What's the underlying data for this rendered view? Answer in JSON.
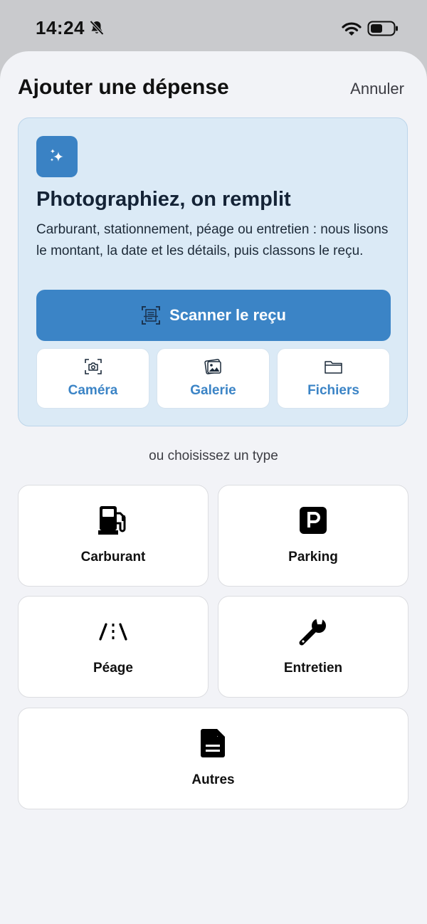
{
  "status_bar": {
    "time": "14:24"
  },
  "header": {
    "title": "Ajouter une dépense",
    "cancel_label": "Annuler"
  },
  "scan_card": {
    "title": "Photographiez, on remplit",
    "description": "Carburant, stationnement, péage ou entretien : nous lisons le montant, la date et les détails, puis classons le reçu.",
    "scan_button_label": "Scanner le reçu",
    "sources": [
      {
        "label": "Caméra",
        "icon": "camera-icon"
      },
      {
        "label": "Galerie",
        "icon": "gallery-icon"
      },
      {
        "label": "Fichiers",
        "icon": "folder-icon"
      }
    ]
  },
  "divider_label": "ou choisissez un type",
  "types": [
    {
      "label": "Carburant",
      "icon": "fuel-pump-icon"
    },
    {
      "label": "Parking",
      "icon": "parking-icon"
    },
    {
      "label": "Péage",
      "icon": "road-icon"
    },
    {
      "label": "Entretien",
      "icon": "wrench-icon"
    },
    {
      "label": "Autres",
      "icon": "document-icon"
    }
  ],
  "colors": {
    "accent": "#3b84c6",
    "card_bg": "#dbeaf6",
    "sheet_bg": "#f2f3f7"
  }
}
